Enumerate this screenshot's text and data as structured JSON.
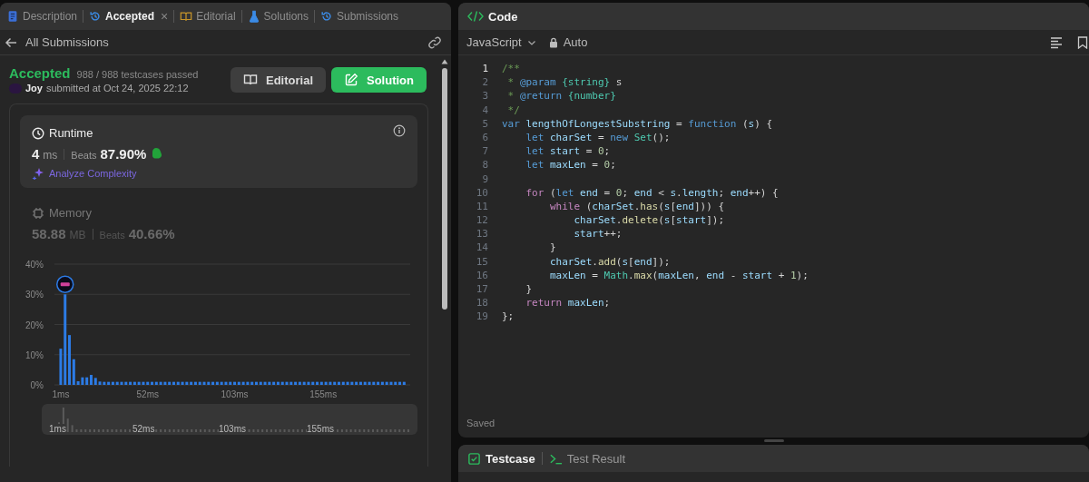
{
  "left_panel": {
    "tabs": [
      {
        "label": "Description",
        "kind": "description",
        "selected": false,
        "closable": false
      },
      {
        "label": "Accepted",
        "kind": "accepted",
        "selected": true,
        "closable": true,
        "close": "×"
      },
      {
        "label": "Editorial",
        "kind": "editorial",
        "selected": false,
        "closable": false
      },
      {
        "label": "Solutions",
        "kind": "solutions",
        "selected": false,
        "closable": false
      },
      {
        "label": "Submissions",
        "kind": "submissions",
        "selected": false,
        "closable": false
      }
    ],
    "back_link": "All Submissions",
    "result": {
      "status": "Accepted",
      "passed": "988 / 988 testcases passed",
      "user": "Joy",
      "submitted": "submitted at Oct 24, 2025 22:12"
    },
    "buttons": [
      {
        "label": "Editorial",
        "kind": "secondary"
      },
      {
        "label": "Solution",
        "kind": "primary"
      }
    ],
    "metrics": [
      {
        "kind": "runtime",
        "title": "Runtime",
        "value": "4",
        "unit": "ms",
        "beats_label": "Beats",
        "beats": "87.90%",
        "selected": true,
        "link": "Analyze Complexity"
      },
      {
        "kind": "memory",
        "title": "Memory",
        "value": "58.88",
        "unit": "MB",
        "beats_label": "Beats",
        "beats": "40.66%",
        "selected": false
      }
    ],
    "chart_data": {
      "type": "bar",
      "grid": true,
      "x": [
        1,
        3.55,
        6.1,
        8.65,
        11.2,
        13.75,
        16.3,
        18.85,
        21.4,
        23.95,
        26.5,
        29.05,
        31.6,
        34.15,
        36.7,
        39.25,
        41.8,
        44.35,
        46.9,
        49.45,
        52,
        54.55,
        57.1,
        59.65,
        62.2,
        64.75,
        67.3,
        69.85,
        72.4,
        74.95,
        77.5,
        80.05,
        82.6,
        85.15,
        87.7,
        90.25,
        92.8,
        95.35,
        97.9,
        100.45,
        103,
        105.55,
        108.1,
        110.65,
        113.2,
        115.75,
        118.3,
        120.85,
        123.4,
        125.95,
        128.5,
        131.05,
        133.6,
        136.15,
        138.7,
        141.25,
        143.8,
        146.35,
        148.9,
        151.45,
        154,
        156.55,
        159.1,
        161.65,
        164.2,
        166.75,
        169.3,
        171.85,
        174.4,
        176.95,
        179.5,
        182.05,
        184.6,
        187.15,
        189.7,
        192.25,
        194.8,
        197.35,
        199.9,
        202.45
      ],
      "series": [
        {
          "color": "#2c7be5",
          "values": [
            12,
            30,
            16.5,
            8.5,
            1.2,
            2.5,
            2.5,
            3.3,
            2.3,
            1.1,
            1,
            1,
            1,
            1,
            1,
            1,
            1,
            1,
            1,
            1,
            1,
            1,
            1,
            1,
            1,
            1,
            1,
            1,
            1,
            1,
            1,
            1,
            1,
            1,
            1,
            1,
            1,
            1,
            1,
            1,
            1,
            1,
            1,
            1,
            1,
            1,
            1,
            1,
            1,
            1,
            1,
            1,
            1,
            1,
            1,
            1,
            1,
            1,
            1,
            1,
            1,
            1,
            1,
            1,
            1,
            1,
            1,
            1,
            1,
            1,
            1,
            1,
            1,
            1,
            1,
            1,
            1,
            1,
            1,
            1
          ]
        }
      ],
      "xlim": [
        -2.7,
        206
      ],
      "ylim": [
        0,
        40
      ],
      "yticks": [
        {
          "value": 0,
          "label": "0%"
        },
        {
          "value": 10,
          "label": "10%"
        },
        {
          "value": 20,
          "label": "20%"
        },
        {
          "value": 30,
          "label": "30%"
        },
        {
          "value": 40,
          "label": "40%"
        }
      ],
      "xticks": [
        {
          "value": 1,
          "label": "1ms"
        },
        {
          "value": 52,
          "label": "52ms"
        },
        {
          "value": 103,
          "label": "103ms"
        },
        {
          "value": 155,
          "label": "155ms"
        }
      ]
    },
    "overview_ticks": [
      "1ms",
      "52ms",
      "103ms",
      "155ms"
    ]
  },
  "code_panel": {
    "title": "Code",
    "language": "JavaScript",
    "mode": "Auto",
    "lines": [
      {
        "n": "1",
        "active": true,
        "tokens": [
          {
            "kind": "comment",
            "text": "/**"
          }
        ]
      },
      {
        "n": "2",
        "active": false,
        "tokens": [
          {
            "kind": "comment",
            "text": " * "
          },
          {
            "kind": "doc_tag",
            "text": "@param"
          },
          {
            "kind": "doc_type",
            "text": " {string}"
          },
          {
            "kind": "plain",
            "text": " s"
          }
        ]
      },
      {
        "n": "3",
        "active": false,
        "tokens": [
          {
            "kind": "comment",
            "text": " * "
          },
          {
            "kind": "doc_tag",
            "text": "@return"
          },
          {
            "kind": "doc_type",
            "text": " {number}"
          }
        ]
      },
      {
        "n": "4",
        "active": false,
        "tokens": [
          {
            "kind": "comment",
            "text": " */"
          }
        ]
      },
      {
        "n": "5",
        "active": false,
        "tokens": [
          {
            "kind": "keyword",
            "text": "var"
          },
          {
            "kind": "identifier",
            "text": " lengthOfLongestSubstring"
          },
          {
            "kind": "plain",
            "text": " = "
          },
          {
            "kind": "keyword",
            "text": "function"
          },
          {
            "kind": "plain",
            "text": " ("
          },
          {
            "kind": "identifier",
            "text": "s"
          },
          {
            "kind": "plain",
            "text": ") {"
          }
        ]
      },
      {
        "n": "6",
        "active": false,
        "tokens": [
          {
            "kind": "keyword",
            "text": "    let"
          },
          {
            "kind": "identifier",
            "text": " charSet"
          },
          {
            "kind": "plain",
            "text": " = "
          },
          {
            "kind": "keyword",
            "text": "new"
          },
          {
            "kind": "type",
            "text": " Set"
          },
          {
            "kind": "plain",
            "text": "();"
          }
        ]
      },
      {
        "n": "7",
        "active": false,
        "tokens": [
          {
            "kind": "keyword",
            "text": "    let"
          },
          {
            "kind": "identifier",
            "text": " start"
          },
          {
            "kind": "plain",
            "text": " = "
          },
          {
            "kind": "number",
            "text": "0"
          },
          {
            "kind": "plain",
            "text": ";"
          }
        ]
      },
      {
        "n": "8",
        "active": false,
        "tokens": [
          {
            "kind": "keyword",
            "text": "    let"
          },
          {
            "kind": "identifier",
            "text": " maxLen"
          },
          {
            "kind": "plain",
            "text": " = "
          },
          {
            "kind": "number",
            "text": "0"
          },
          {
            "kind": "plain",
            "text": ";"
          }
        ]
      },
      {
        "n": "9",
        "active": false
      },
      {
        "n": "10",
        "active": false,
        "tokens": [
          {
            "kind": "control",
            "text": "    for"
          },
          {
            "kind": "plain",
            "text": " ("
          },
          {
            "kind": "keyword",
            "text": "let"
          },
          {
            "kind": "identifier",
            "text": " end"
          },
          {
            "kind": "plain",
            "text": " = "
          },
          {
            "kind": "number",
            "text": "0"
          },
          {
            "kind": "plain",
            "text": "; "
          },
          {
            "kind": "identifier",
            "text": "end"
          },
          {
            "kind": "plain",
            "text": " < "
          },
          {
            "kind": "identifier",
            "text": "s"
          },
          {
            "kind": "plain",
            "text": "."
          },
          {
            "kind": "identifier",
            "text": "length"
          },
          {
            "kind": "plain",
            "text": "; "
          },
          {
            "kind": "identifier",
            "text": "end"
          },
          {
            "kind": "plain",
            "text": "++) {"
          }
        ]
      },
      {
        "n": "11",
        "active": false,
        "tokens": [
          {
            "kind": "control",
            "text": "        while"
          },
          {
            "kind": "plain",
            "text": " ("
          },
          {
            "kind": "identifier",
            "text": "charSet"
          },
          {
            "kind": "plain",
            "text": "."
          },
          {
            "kind": "function",
            "text": "has"
          },
          {
            "kind": "plain",
            "text": "("
          },
          {
            "kind": "identifier",
            "text": "s"
          },
          {
            "kind": "plain",
            "text": "["
          },
          {
            "kind": "identifier",
            "text": "end"
          },
          {
            "kind": "plain",
            "text": "])) {"
          }
        ]
      },
      {
        "n": "12",
        "active": false,
        "tokens": [
          {
            "kind": "identifier",
            "text": "            charSet"
          },
          {
            "kind": "plain",
            "text": "."
          },
          {
            "kind": "function",
            "text": "delete"
          },
          {
            "kind": "plain",
            "text": "("
          },
          {
            "kind": "identifier",
            "text": "s"
          },
          {
            "kind": "plain",
            "text": "["
          },
          {
            "kind": "identifier",
            "text": "start"
          },
          {
            "kind": "plain",
            "text": "]);"
          }
        ]
      },
      {
        "n": "13",
        "active": false,
        "tokens": [
          {
            "kind": "identifier",
            "text": "            start"
          },
          {
            "kind": "plain",
            "text": "++;"
          }
        ]
      },
      {
        "n": "14",
        "active": false,
        "tokens": [
          {
            "kind": "plain",
            "text": "        }"
          }
        ]
      },
      {
        "n": "15",
        "active": false,
        "tokens": [
          {
            "kind": "identifier",
            "text": "        charSet"
          },
          {
            "kind": "plain",
            "text": "."
          },
          {
            "kind": "function",
            "text": "add"
          },
          {
            "kind": "plain",
            "text": "("
          },
          {
            "kind": "identifier",
            "text": "s"
          },
          {
            "kind": "plain",
            "text": "["
          },
          {
            "kind": "identifier",
            "text": "end"
          },
          {
            "kind": "plain",
            "text": "]);"
          }
        ]
      },
      {
        "n": "16",
        "active": false,
        "tokens": [
          {
            "kind": "identifier",
            "text": "        maxLen"
          },
          {
            "kind": "plain",
            "text": " = "
          },
          {
            "kind": "type",
            "text": "Math"
          },
          {
            "kind": "plain",
            "text": "."
          },
          {
            "kind": "function",
            "text": "max"
          },
          {
            "kind": "plain",
            "text": "("
          },
          {
            "kind": "identifier",
            "text": "maxLen"
          },
          {
            "kind": "plain",
            "text": ", "
          },
          {
            "kind": "identifier",
            "text": "end"
          },
          {
            "kind": "plain",
            "text": " - "
          },
          {
            "kind": "identifier",
            "text": "start"
          },
          {
            "kind": "plain",
            "text": " + "
          },
          {
            "kind": "number",
            "text": "1"
          },
          {
            "kind": "plain",
            "text": ");"
          }
        ]
      },
      {
        "n": "17",
        "active": false,
        "tokens": [
          {
            "kind": "plain",
            "text": "    }"
          }
        ]
      },
      {
        "n": "18",
        "active": false,
        "tokens": [
          {
            "kind": "control",
            "text": "    return"
          },
          {
            "kind": "identifier",
            "text": " maxLen"
          },
          {
            "kind": "plain",
            "text": ";"
          }
        ]
      },
      {
        "n": "19",
        "active": false,
        "tokens": [
          {
            "kind": "plain",
            "text": "};"
          }
        ]
      }
    ],
    "status": "Saved"
  },
  "bottom_panel": {
    "tabs": [
      {
        "label": "Testcase",
        "kind": "testcase",
        "selected": true
      },
      {
        "label": "Test Result",
        "kind": "result",
        "selected": false
      }
    ]
  }
}
